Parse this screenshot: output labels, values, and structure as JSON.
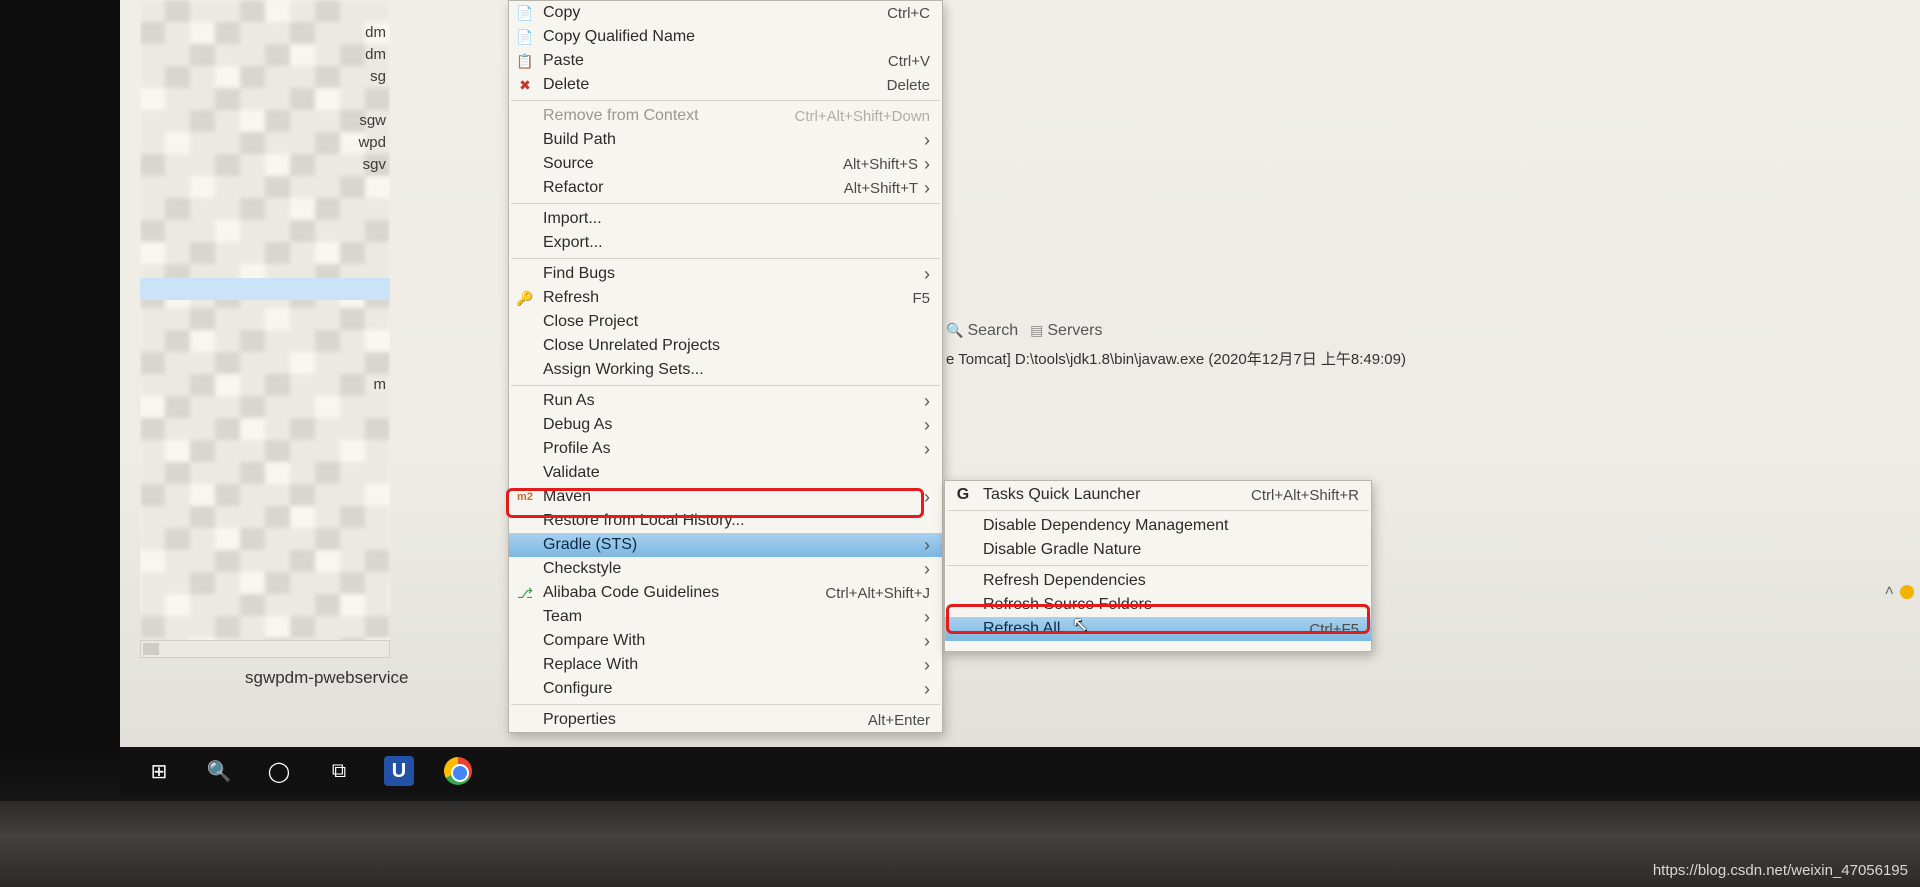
{
  "explorer": {
    "visible_suffixes": [
      "",
      "dm",
      "dm",
      "sg",
      "",
      "sgw",
      "wpd",
      "sgv",
      "",
      "",
      "",
      "",
      "",
      "",
      "",
      "",
      "",
      "m"
    ]
  },
  "status_project": "sgwpdm-pwebservice",
  "menu": [
    {
      "label": "Copy",
      "shortcut": "Ctrl+C",
      "icon": "📄"
    },
    {
      "label": "Copy Qualified Name",
      "shortcut": "",
      "icon": "📄"
    },
    {
      "label": "Paste",
      "shortcut": "Ctrl+V",
      "icon": "📋"
    },
    {
      "label": "Delete",
      "shortcut": "Delete",
      "icon": "✖",
      "iconColor": "#c0392b"
    },
    {
      "sep": true
    },
    {
      "label": "Remove from Context",
      "shortcut": "Ctrl+Alt+Shift+Down",
      "icon": "",
      "disabled": true
    },
    {
      "label": "Build Path",
      "submenu": true
    },
    {
      "label": "Source",
      "shortcut": "Alt+Shift+S",
      "submenu": true
    },
    {
      "label": "Refactor",
      "shortcut": "Alt+Shift+T",
      "submenu": true
    },
    {
      "sep": true
    },
    {
      "label": "Import...",
      "icon": ""
    },
    {
      "label": "Export...",
      "icon": ""
    },
    {
      "sep": true
    },
    {
      "label": "Find Bugs",
      "submenu": true
    },
    {
      "label": "Refresh",
      "shortcut": "F5",
      "icon": "🔑",
      "iconColor": "#caa23a"
    },
    {
      "label": "Close Project"
    },
    {
      "label": "Close Unrelated Projects"
    },
    {
      "label": "Assign Working Sets..."
    },
    {
      "sep": true
    },
    {
      "label": "Run As",
      "submenu": true
    },
    {
      "label": "Debug As",
      "submenu": true
    },
    {
      "label": "Profile As",
      "submenu": true
    },
    {
      "label": "Validate"
    },
    {
      "label": "Maven",
      "submenu": true,
      "icon": "m2",
      "iconColor": "#cc6b2c"
    },
    {
      "label": "Restore from Local History..."
    },
    {
      "label": "Gradle (STS)",
      "submenu": true,
      "highlight": true
    },
    {
      "label": "Checkstyle",
      "submenu": true
    },
    {
      "label": "Alibaba Code Guidelines",
      "shortcut": "Ctrl+Alt+Shift+J",
      "icon": "⎇",
      "iconColor": "#3a9b4e"
    },
    {
      "label": "Team",
      "submenu": true
    },
    {
      "label": "Compare With",
      "submenu": true
    },
    {
      "label": "Replace With",
      "submenu": true
    },
    {
      "label": "Configure",
      "submenu": true
    },
    {
      "sep": true
    },
    {
      "label": "Properties",
      "shortcut": "Alt+Enter"
    }
  ],
  "submenu": [
    {
      "label": "Tasks Quick Launcher",
      "shortcut": "Ctrl+Alt+Shift+R",
      "icon": "G"
    },
    {
      "sep": true
    },
    {
      "label": "Disable Dependency Management"
    },
    {
      "label": "Disable Gradle Nature"
    },
    {
      "sep": true
    },
    {
      "label": "Refresh Dependencies"
    },
    {
      "label": "Refresh Source Folders"
    },
    {
      "label": "Refresh All",
      "shortcut": "Ctrl+F5",
      "highlight": true
    }
  ],
  "tabs": {
    "search": "Search",
    "servers": "Servers"
  },
  "console_line": "e Tomcat] D:\\tools\\jdk1.8\\bin\\javaw.exe (2020年12月7日 上午8:49:09)",
  "watermark": "https://blog.csdn.net/weixin_47056195"
}
